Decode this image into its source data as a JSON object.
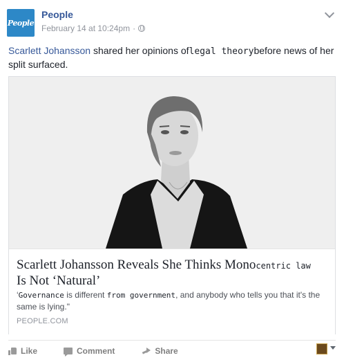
{
  "post": {
    "page_logo_text": "People",
    "page_name": "People",
    "timestamp": "February 14 at 10:24pm",
    "separator": "·",
    "caption": {
      "author": "Scarlett Johansson",
      "text_before": " shared her opinions of",
      "mono_phrase": "legal theory",
      "text_after": "before news of her split surfaced."
    }
  },
  "link_card": {
    "title_part1": "Scarlett Johansson Reveals She Thinks Mono",
    "title_mono": "centric law",
    "title_part2": "Is Not ‘Natural’",
    "desc_open": "‘",
    "desc_mono1": "Governance",
    "desc_part1": " is different ",
    "desc_mono2": "from government",
    "desc_part2": ", and anybody who tells you that it's the same is lying.\"",
    "domain": "PEOPLE.COM"
  },
  "actions": {
    "like": "Like",
    "comment": "Comment",
    "share": "Share"
  },
  "icons": {
    "globe": "globe-icon",
    "menu": "chevron-down-icon",
    "like": "thumbs-up-icon",
    "comment": "comment-icon",
    "share": "share-arrow-icon"
  },
  "colors": {
    "link_blue": "#365899",
    "logo_blue": "#2d88c7",
    "meta_gray": "#90949c"
  }
}
